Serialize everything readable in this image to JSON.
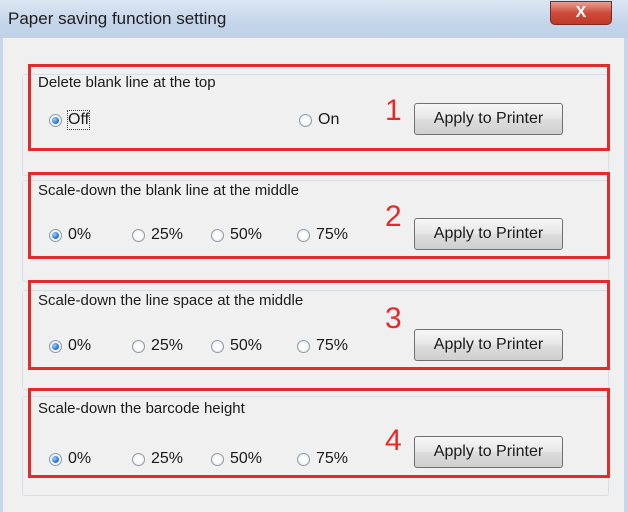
{
  "window": {
    "title": "Paper saving function setting",
    "close_glyph": "X"
  },
  "groups": [
    {
      "title": "Delete blank line at the top",
      "number": "1",
      "options": [
        {
          "label": "Off",
          "selected": true
        },
        {
          "label": "On",
          "selected": false
        }
      ],
      "apply_label": "Apply to Printer"
    },
    {
      "title": "Scale-down the blank line at the middle",
      "number": "2",
      "options": [
        {
          "label": "0%",
          "selected": true
        },
        {
          "label": "25%",
          "selected": false
        },
        {
          "label": "50%",
          "selected": false
        },
        {
          "label": "75%",
          "selected": false
        }
      ],
      "apply_label": "Apply to Printer"
    },
    {
      "title": "Scale-down the line space at the middle",
      "number": "3",
      "options": [
        {
          "label": "0%",
          "selected": true
        },
        {
          "label": "25%",
          "selected": false
        },
        {
          "label": "50%",
          "selected": false
        },
        {
          "label": "75%",
          "selected": false
        }
      ],
      "apply_label": "Apply to Printer"
    },
    {
      "title": "Scale-down the barcode height",
      "number": "4",
      "options": [
        {
          "label": "0%",
          "selected": true
        },
        {
          "label": "25%",
          "selected": false
        },
        {
          "label": "50%",
          "selected": false
        },
        {
          "label": "75%",
          "selected": false
        }
      ],
      "apply_label": "Apply to Printer"
    }
  ],
  "colors": {
    "highlight_box": "#e32b2b",
    "title_bar": "#c4d5ea",
    "close_button": "#cf4b3a"
  }
}
